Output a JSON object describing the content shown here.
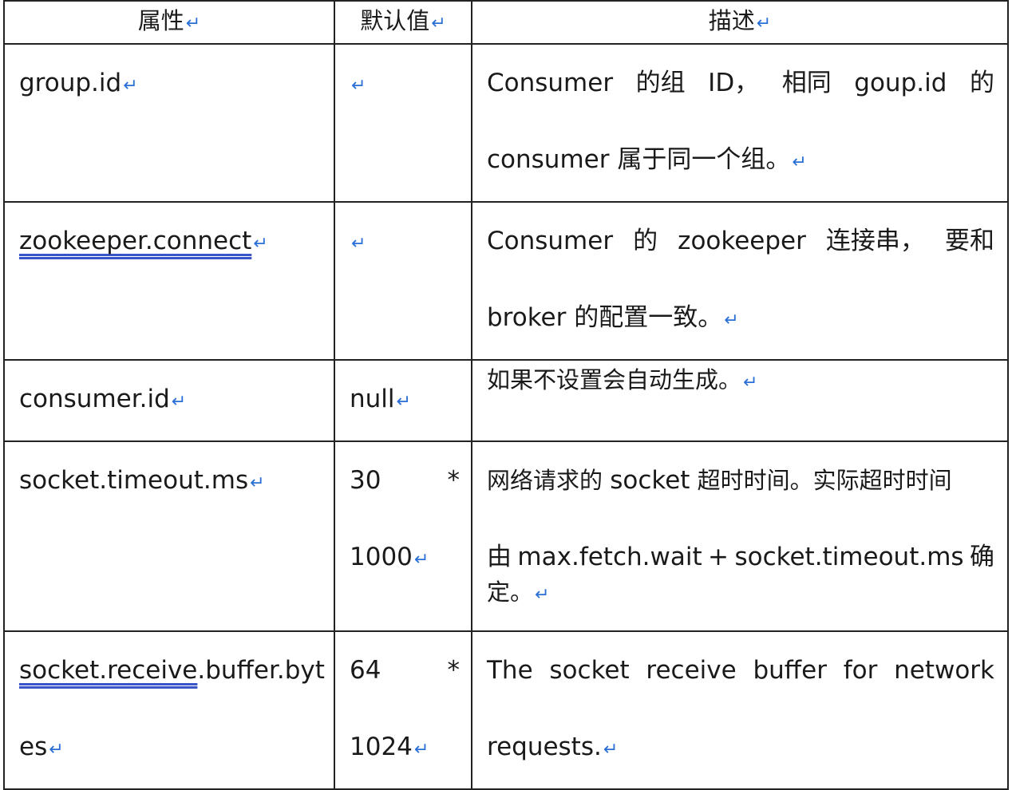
{
  "header": {
    "col_property": "属性",
    "col_default": "默认值",
    "col_description": "描述"
  },
  "return_mark": "↵",
  "rows": [
    {
      "property": "group.id",
      "default": "",
      "desc_line1": "Consumer 的组 ID，相同 goup.id 的",
      "desc_line2": "consumer 属于同一个组。"
    },
    {
      "property": "zookeeper.connect",
      "default": "",
      "desc_line1": "Consumer 的 zookeeper 连接串，要和",
      "desc_line2": "broker 的配置一致。"
    },
    {
      "property": "consumer.id",
      "default": "null",
      "desc_line1": "如果不设置会自动生成。"
    },
    {
      "property": "socket.timeout.ms",
      "default_a": "30",
      "default_star": "*",
      "default_b": "1000",
      "desc_line1": "网络请求的 socket 超时时间。实际超时时间",
      "desc_line2": "由 max.fetch.wait + socket.timeout.ms 确",
      "desc_line3": "定。"
    },
    {
      "property_a": "socket.receive",
      "property_b": ".buffer.byt",
      "property_c": "es",
      "default_a": "64",
      "default_star": "*",
      "default_b": "1024",
      "desc_line1": "The socket receive buffer for network",
      "desc_line2": "requests."
    }
  ]
}
